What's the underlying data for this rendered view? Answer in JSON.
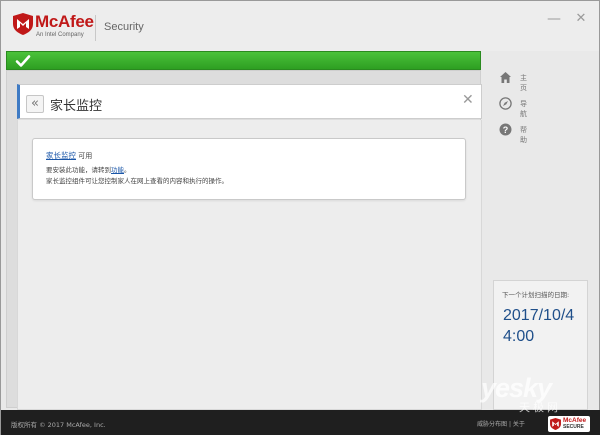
{
  "header": {
    "brand": "McAfee",
    "brand_sub": "An Intel Company",
    "product": "Security",
    "minimize_label": "—",
    "close_label": "✕"
  },
  "statusbar": {
    "state": "protected",
    "color": "#3bb22c",
    "icon": "check-icon"
  },
  "panel": {
    "back_label": "«",
    "title": "家长监控",
    "close_label": "✕",
    "accent_color": "#3f7bc4"
  },
  "card": {
    "link_label": "家长监控",
    "status": "可用",
    "line2_prefix": "要安装此功能，请转到",
    "line2_link": "功能",
    "line2_suffix": "。",
    "line3": "家长监控组件可让您控制家人在网上查看的内容和执行的操作。"
  },
  "sidebar": {
    "items": [
      {
        "label": "主页",
        "icon": "home-icon"
      },
      {
        "label": "导航",
        "icon": "compass-icon"
      },
      {
        "label": "帮助",
        "icon": "help-icon"
      }
    ]
  },
  "schedule": {
    "label": "下一个计划扫描的日期:",
    "date": "2017/10/4",
    "time": "4:00"
  },
  "footer": {
    "copyright": "版权所有 © 2017 McAfee, Inc.",
    "link1": "威胁分布图",
    "separator": "|",
    "link2": "关于",
    "badge_line1": "McAfee",
    "badge_line2": "SECURE"
  },
  "watermark": {
    "text1": "yesky",
    "text2": "天极网"
  }
}
